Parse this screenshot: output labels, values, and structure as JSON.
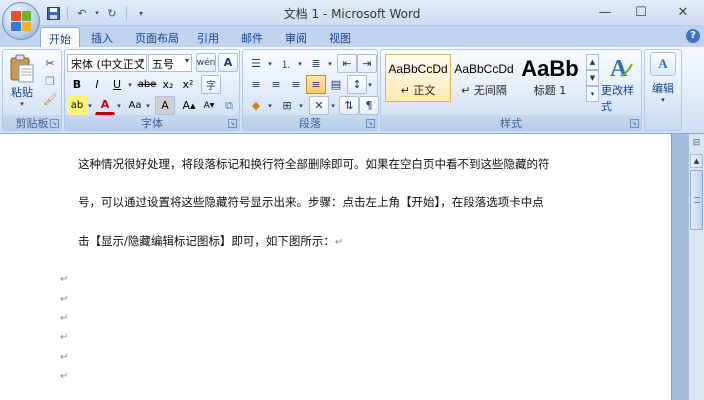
{
  "window": {
    "title": "文档 1 - Microsoft Word",
    "controls": {
      "minimize": "—",
      "maximize": "☐",
      "close": "✕"
    }
  },
  "qat": {
    "icons": [
      "save-icon",
      "undo-icon",
      "redo-icon",
      "customize-icon"
    ]
  },
  "tabs": [
    {
      "label": "开始",
      "active": true
    },
    {
      "label": "插入"
    },
    {
      "label": "页面布局"
    },
    {
      "label": "引用"
    },
    {
      "label": "邮件"
    },
    {
      "label": "审阅"
    },
    {
      "label": "视图"
    }
  ],
  "ribbon": {
    "clipboard": {
      "label": "剪贴板",
      "paste_label": "粘贴"
    },
    "font": {
      "label": "字体",
      "font_name": "宋体 (中文正文",
      "font_size": "五号",
      "bold": "B",
      "italic": "I",
      "underline": "U",
      "strike": "abe",
      "subscript": "x₂",
      "superscript": "x²",
      "highlight": "ab",
      "font_color": "A",
      "case": "Aa",
      "char_border": "A",
      "char_shade": "A",
      "grow": "A",
      "shrink": "A",
      "phonetic": "wén",
      "enclosed": "字"
    },
    "paragraph": {
      "label": "段落"
    },
    "styles": {
      "label": "样式",
      "items": [
        {
          "sample": "AaBbCcDd",
          "name": "↵ 正文",
          "selected": true
        },
        {
          "sample": "AaBbCcDd",
          "name": "↵ 无间隔"
        },
        {
          "sample": "AaBb",
          "name": "标题 1",
          "big": true
        }
      ],
      "change_styles": "更改样式"
    },
    "editing": {
      "label": "编辑"
    }
  },
  "document": {
    "lines": [
      "这种情况很好处理，将段落标记和换行符全部删除即可。如果在空白页中看不到这些隐藏的符",
      "号，可以通过设置将这些隐藏符号显示出来。步骤：点击左上角【开始】，在段落选项卡中点",
      "击【显示/隐藏编辑标记图标】即可，如下图所示："
    ],
    "paragraph_mark": "↵",
    "empty_paragraphs": [
      "↵",
      "↵",
      "↵",
      "↵",
      "↵",
      "↵"
    ]
  },
  "colors": {
    "accent": "#15428b",
    "ribbon_bg": "#dfeaf8",
    "selected_style": "#ffe9b4"
  }
}
